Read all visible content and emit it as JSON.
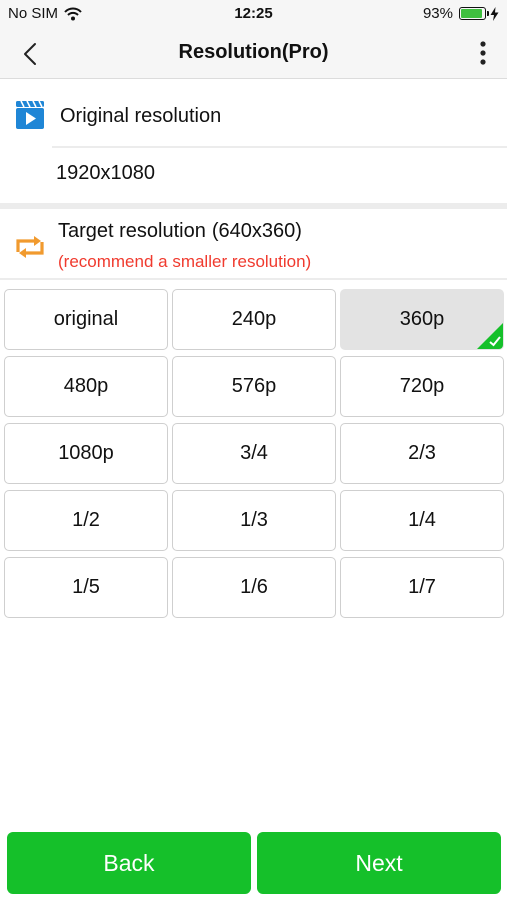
{
  "status_bar": {
    "carrier": "No SIM",
    "time": "12:25",
    "battery": "93%",
    "battery_level_percent": 93
  },
  "nav": {
    "title": "Resolution(Pro)",
    "back_icon": "chevron-left-icon",
    "more_icon": "vertical-ellipsis-icon"
  },
  "original": {
    "label": "Original resolution",
    "value": "1920x1080",
    "icon": "video-clapper-icon"
  },
  "target": {
    "label": "Target resolution",
    "value": "(640x360)",
    "note": "(recommend a smaller resolution)",
    "icon": "convert-arrows-icon"
  },
  "options": [
    {
      "label": "original",
      "selected": false
    },
    {
      "label": "240p",
      "selected": false
    },
    {
      "label": "360p",
      "selected": true
    },
    {
      "label": "480p",
      "selected": false
    },
    {
      "label": "576p",
      "selected": false
    },
    {
      "label": "720p",
      "selected": false
    },
    {
      "label": "1080p",
      "selected": false
    },
    {
      "label": "3/4",
      "selected": false
    },
    {
      "label": "2/3",
      "selected": false
    },
    {
      "label": "1/2",
      "selected": false
    },
    {
      "label": "1/3",
      "selected": false
    },
    {
      "label": "1/4",
      "selected": false
    },
    {
      "label": "1/5",
      "selected": false
    },
    {
      "label": "1/6",
      "selected": false
    },
    {
      "label": "1/7",
      "selected": false
    }
  ],
  "buttons": {
    "back": "Back",
    "next": "Next"
  },
  "colors": {
    "accent_green": "#15c02a",
    "warning_red": "#f03a2e",
    "icon_blue": "#1f86d6",
    "icon_orange": "#f19a2e"
  }
}
